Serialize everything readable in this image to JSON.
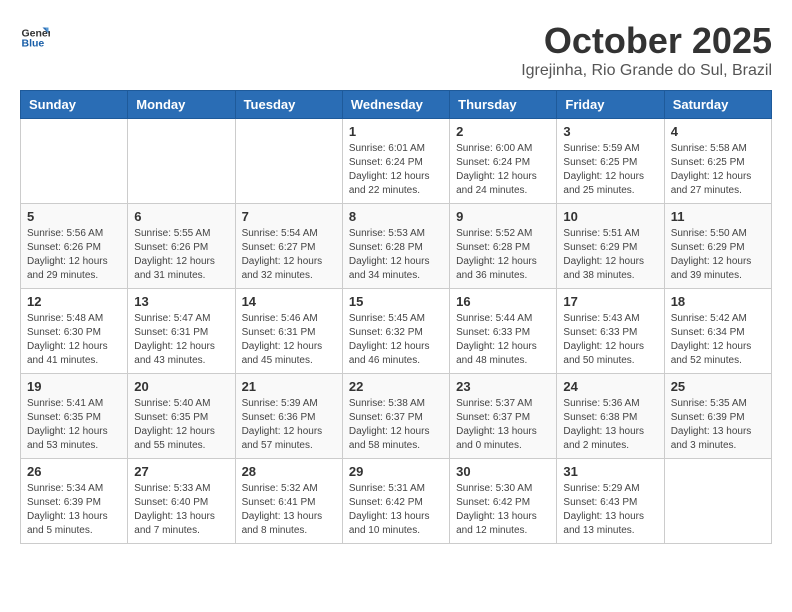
{
  "header": {
    "logo_general": "General",
    "logo_blue": "Blue",
    "month": "October 2025",
    "location": "Igrejinha, Rio Grande do Sul, Brazil"
  },
  "weekdays": [
    "Sunday",
    "Monday",
    "Tuesday",
    "Wednesday",
    "Thursday",
    "Friday",
    "Saturday"
  ],
  "weeks": [
    [
      {
        "day": "",
        "info": ""
      },
      {
        "day": "",
        "info": ""
      },
      {
        "day": "",
        "info": ""
      },
      {
        "day": "1",
        "info": "Sunrise: 6:01 AM\nSunset: 6:24 PM\nDaylight: 12 hours\nand 22 minutes."
      },
      {
        "day": "2",
        "info": "Sunrise: 6:00 AM\nSunset: 6:24 PM\nDaylight: 12 hours\nand 24 minutes."
      },
      {
        "day": "3",
        "info": "Sunrise: 5:59 AM\nSunset: 6:25 PM\nDaylight: 12 hours\nand 25 minutes."
      },
      {
        "day": "4",
        "info": "Sunrise: 5:58 AM\nSunset: 6:25 PM\nDaylight: 12 hours\nand 27 minutes."
      }
    ],
    [
      {
        "day": "5",
        "info": "Sunrise: 5:56 AM\nSunset: 6:26 PM\nDaylight: 12 hours\nand 29 minutes."
      },
      {
        "day": "6",
        "info": "Sunrise: 5:55 AM\nSunset: 6:26 PM\nDaylight: 12 hours\nand 31 minutes."
      },
      {
        "day": "7",
        "info": "Sunrise: 5:54 AM\nSunset: 6:27 PM\nDaylight: 12 hours\nand 32 minutes."
      },
      {
        "day": "8",
        "info": "Sunrise: 5:53 AM\nSunset: 6:28 PM\nDaylight: 12 hours\nand 34 minutes."
      },
      {
        "day": "9",
        "info": "Sunrise: 5:52 AM\nSunset: 6:28 PM\nDaylight: 12 hours\nand 36 minutes."
      },
      {
        "day": "10",
        "info": "Sunrise: 5:51 AM\nSunset: 6:29 PM\nDaylight: 12 hours\nand 38 minutes."
      },
      {
        "day": "11",
        "info": "Sunrise: 5:50 AM\nSunset: 6:29 PM\nDaylight: 12 hours\nand 39 minutes."
      }
    ],
    [
      {
        "day": "12",
        "info": "Sunrise: 5:48 AM\nSunset: 6:30 PM\nDaylight: 12 hours\nand 41 minutes."
      },
      {
        "day": "13",
        "info": "Sunrise: 5:47 AM\nSunset: 6:31 PM\nDaylight: 12 hours\nand 43 minutes."
      },
      {
        "day": "14",
        "info": "Sunrise: 5:46 AM\nSunset: 6:31 PM\nDaylight: 12 hours\nand 45 minutes."
      },
      {
        "day": "15",
        "info": "Sunrise: 5:45 AM\nSunset: 6:32 PM\nDaylight: 12 hours\nand 46 minutes."
      },
      {
        "day": "16",
        "info": "Sunrise: 5:44 AM\nSunset: 6:33 PM\nDaylight: 12 hours\nand 48 minutes."
      },
      {
        "day": "17",
        "info": "Sunrise: 5:43 AM\nSunset: 6:33 PM\nDaylight: 12 hours\nand 50 minutes."
      },
      {
        "day": "18",
        "info": "Sunrise: 5:42 AM\nSunset: 6:34 PM\nDaylight: 12 hours\nand 52 minutes."
      }
    ],
    [
      {
        "day": "19",
        "info": "Sunrise: 5:41 AM\nSunset: 6:35 PM\nDaylight: 12 hours\nand 53 minutes."
      },
      {
        "day": "20",
        "info": "Sunrise: 5:40 AM\nSunset: 6:35 PM\nDaylight: 12 hours\nand 55 minutes."
      },
      {
        "day": "21",
        "info": "Sunrise: 5:39 AM\nSunset: 6:36 PM\nDaylight: 12 hours\nand 57 minutes."
      },
      {
        "day": "22",
        "info": "Sunrise: 5:38 AM\nSunset: 6:37 PM\nDaylight: 12 hours\nand 58 minutes."
      },
      {
        "day": "23",
        "info": "Sunrise: 5:37 AM\nSunset: 6:37 PM\nDaylight: 13 hours\nand 0 minutes."
      },
      {
        "day": "24",
        "info": "Sunrise: 5:36 AM\nSunset: 6:38 PM\nDaylight: 13 hours\nand 2 minutes."
      },
      {
        "day": "25",
        "info": "Sunrise: 5:35 AM\nSunset: 6:39 PM\nDaylight: 13 hours\nand 3 minutes."
      }
    ],
    [
      {
        "day": "26",
        "info": "Sunrise: 5:34 AM\nSunset: 6:39 PM\nDaylight: 13 hours\nand 5 minutes."
      },
      {
        "day": "27",
        "info": "Sunrise: 5:33 AM\nSunset: 6:40 PM\nDaylight: 13 hours\nand 7 minutes."
      },
      {
        "day": "28",
        "info": "Sunrise: 5:32 AM\nSunset: 6:41 PM\nDaylight: 13 hours\nand 8 minutes."
      },
      {
        "day": "29",
        "info": "Sunrise: 5:31 AM\nSunset: 6:42 PM\nDaylight: 13 hours\nand 10 minutes."
      },
      {
        "day": "30",
        "info": "Sunrise: 5:30 AM\nSunset: 6:42 PM\nDaylight: 13 hours\nand 12 minutes."
      },
      {
        "day": "31",
        "info": "Sunrise: 5:29 AM\nSunset: 6:43 PM\nDaylight: 13 hours\nand 13 minutes."
      },
      {
        "day": "",
        "info": ""
      }
    ]
  ]
}
